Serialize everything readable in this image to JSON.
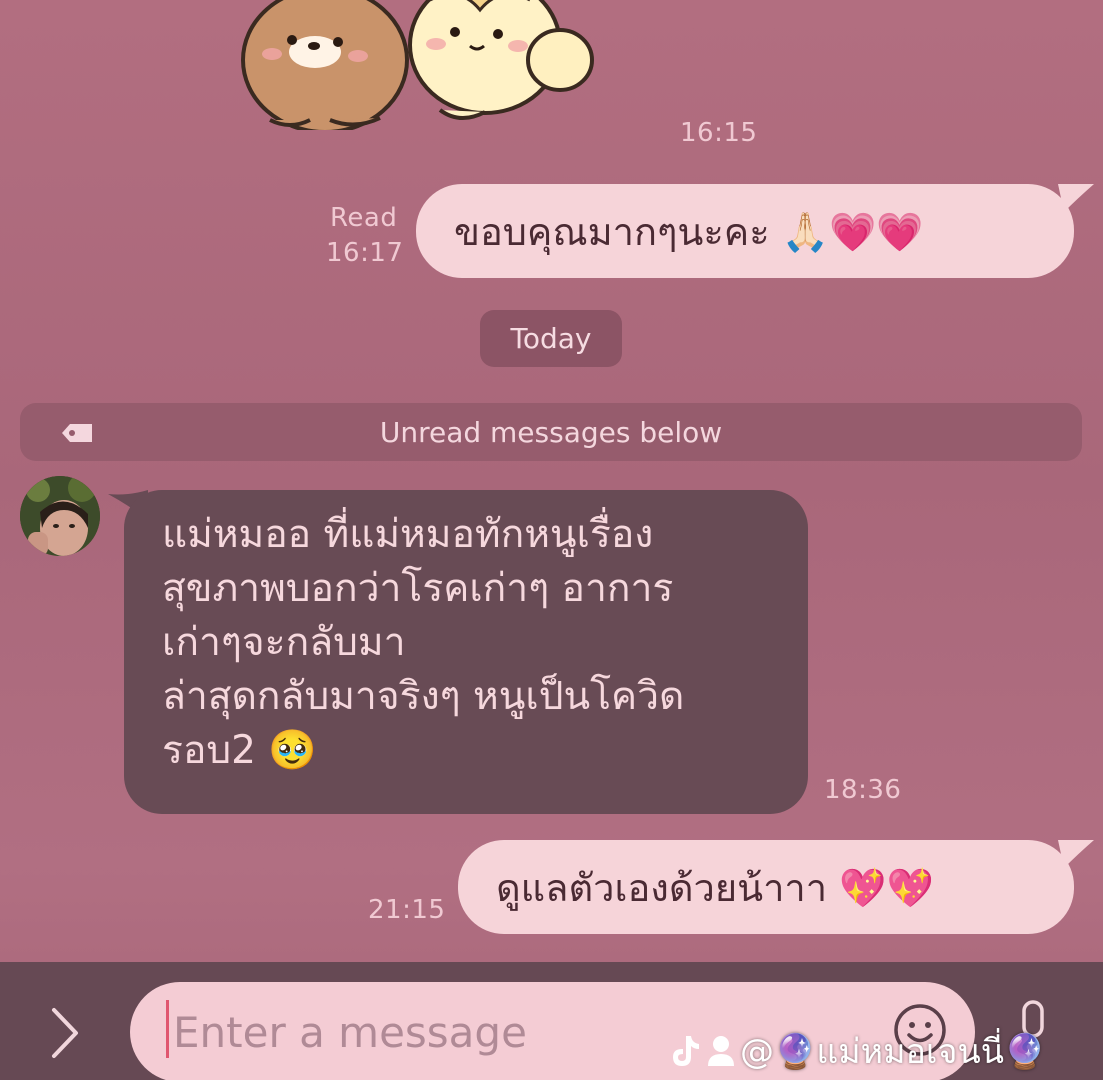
{
  "chat": {
    "sticker_time": "16:15",
    "msg1": {
      "text": "ขอบคุณมากๆนะคะ 🙏🏻💗💗",
      "status": "Read",
      "time": "16:17"
    },
    "date_pill": "Today",
    "unread_label": "Unread messages below",
    "msg2": {
      "lines": [
        "แม่หมออ ที่แม่หมอทักหนูเรื่อง",
        "สุขภาพบอกว่าโรคเก่าๆ อาการ",
        "เก่าๆจะกลับมา",
        "ล่าสุดกลับมาจริงๆ หนูเป็นโควิด",
        "รอบ2 🥹"
      ],
      "time": "18:36"
    },
    "msg3": {
      "text": "ดูแลตัวเองด้วยน้าาา 💖💖",
      "time": "21:15"
    }
  },
  "input": {
    "placeholder": "Enter a message"
  },
  "watermark": {
    "text": "@🔮แม่หมอเจนนี่🔮"
  },
  "colors": {
    "background": "#b26e80",
    "outgoing_bubble": "#f6d4d9",
    "incoming_bubble": "#684b55",
    "input_bar": "#664954"
  },
  "icons": [
    "chevron-right-icon",
    "emoji-icon",
    "mic-icon",
    "tag-icon",
    "tiktok-icon",
    "user-icon"
  ]
}
